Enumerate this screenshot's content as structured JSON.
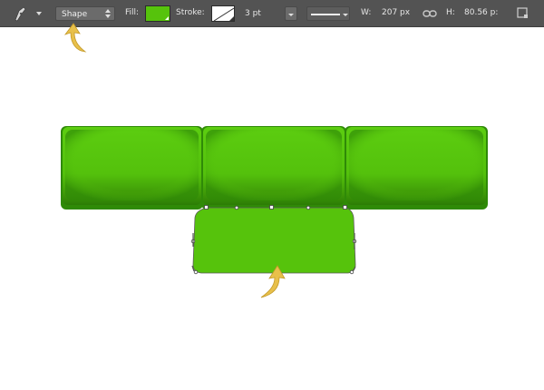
{
  "toolbar": {
    "tool_icon": "pen-icon",
    "mode_label": "Shape",
    "fill_label": "Fill:",
    "fill_color": "#56c30c",
    "stroke_label": "Stroke:",
    "stroke_color": "none",
    "stroke_width": "3 pt",
    "width_label": "W:",
    "width_value": "207 px",
    "link_icon": "link-icon",
    "height_label": "H:",
    "height_value": "80.56 p:",
    "align_icon": "path-align-icon"
  },
  "canvas": {
    "background": "#ffffff",
    "shape_color": "#56c30c",
    "shape_dark": "#2f8a07",
    "annotation_color": "#e8c04a"
  }
}
